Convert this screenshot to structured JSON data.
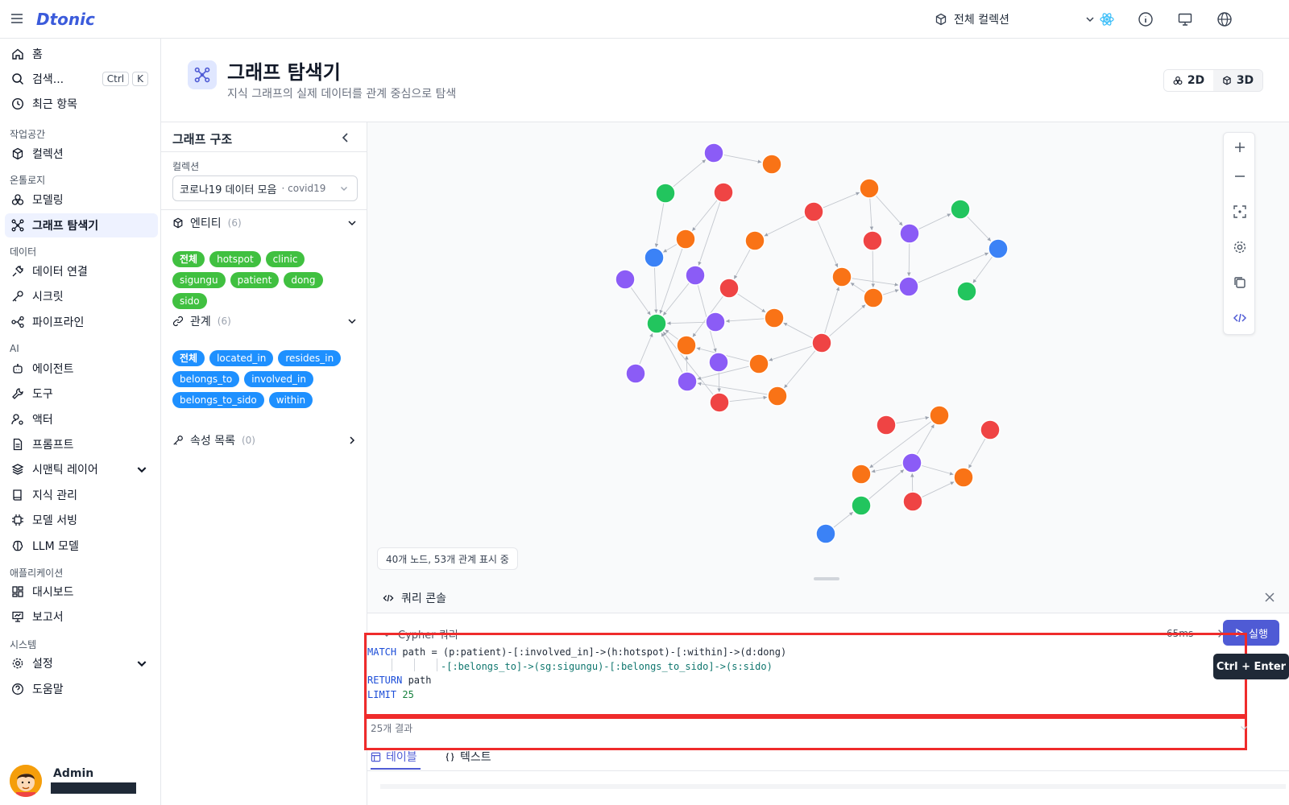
{
  "app": {
    "logo": "Dtonic"
  },
  "topbar": {
    "collection_selector": "전체 컬렉션"
  },
  "sidebar": {
    "search_label": "검색...",
    "search_shortcut_ctrl": "Ctrl",
    "search_shortcut_key": "K",
    "items_top": [
      "홈",
      "최근 항목"
    ],
    "section_workspace": "작업공간",
    "collection": "컬렉션",
    "section_ontology": "온톨로지",
    "modeling": "모델링",
    "graph_explorer": "그래프 탐색기",
    "section_data": "데이터",
    "data_connection": "데이터 연결",
    "secret": "시크릿",
    "pipeline": "파이프라인",
    "section_ai": "AI",
    "agent": "에이전트",
    "tool": "도구",
    "actor": "액터",
    "prompt": "프롬프트",
    "semantic_layer": "시맨틱 레이어",
    "knowledge": "지식 관리",
    "model_serving": "모델 서빙",
    "llm_model": "LLM 모델",
    "section_apps": "애플리케이션",
    "dashboard": "대시보드",
    "report": "보고서",
    "section_system": "시스템",
    "settings": "설정",
    "help": "도움말",
    "user_name": "Admin"
  },
  "header": {
    "title": "그래프 탐색기",
    "subtitle": "지식 그래프의 실제 데이터를 관계 중심으로 탐색",
    "view_2d": "2D",
    "view_3d": "3D"
  },
  "panel": {
    "title": "그래프 구조",
    "collection_label": "컬렉션",
    "collection_value": "코로나19 데이터 모음",
    "collection_sub": "· covid19",
    "entities_title": "엔티티",
    "entities_count": "(6)",
    "entities": [
      "전체",
      "hotspot",
      "clinic",
      "sigungu",
      "patient",
      "dong",
      "sido"
    ],
    "relations_title": "관계",
    "relations_count": "(6)",
    "relations": [
      "전체",
      "located_in",
      "resides_in",
      "belongs_to",
      "involved_in",
      "belongs_to_sido",
      "within"
    ],
    "props_title": "속성 목록",
    "props_count": "(0)"
  },
  "canvas": {
    "status": "40개 노드, 53개 관계 표시 중",
    "colors": {
      "patient": "#8b5cf6",
      "hotspot": "#f97316",
      "clinic": "#ef4444",
      "dong": "#22c55e",
      "sigungu": "#3b82f6"
    }
  },
  "console": {
    "title": "쿼리 콘솔",
    "sub_title": "Cypher 쿼리",
    "elapsed": "65ms",
    "run_label": "실행",
    "tooltip": "Ctrl + Enter",
    "results": "25개 결과",
    "tab_table": "테이블",
    "tab_text": "텍스트",
    "query_line1_kw": "MATCH",
    "query_line1_rest": " path = (p:patient)-[:involved_in]->(h:hotspot)-[:within]->(d:dong)",
    "query_line2": "-[:belongs_to]->(sg:sigungu)-[:belongs_to_sido]->(s:sido)",
    "query_line3_kw": "RETURN",
    "query_line3_rest": " path",
    "query_line4_kw": "LIMIT",
    "query_line4_num": " 25"
  }
}
